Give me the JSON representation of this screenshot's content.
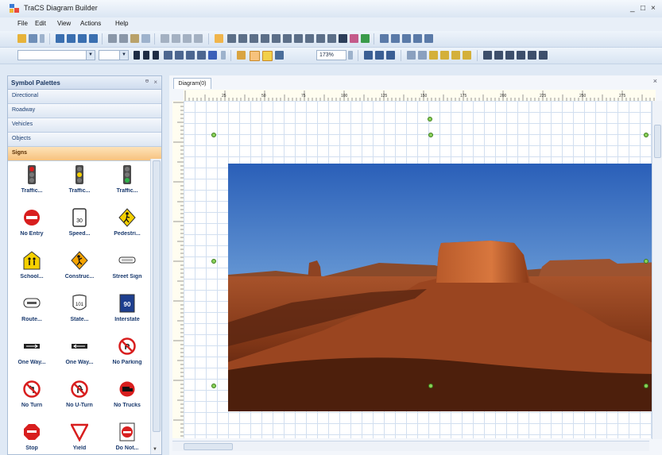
{
  "window": {
    "title": "TraCS Diagram Builder",
    "controls": {
      "minimize": "_",
      "maximize": "□",
      "close": "×"
    }
  },
  "menu": [
    "File",
    "Edit",
    "View",
    "Actions",
    "Help"
  ],
  "toolbar": {
    "zoom_value": "173%"
  },
  "palette": {
    "title": "Symbol Palettes",
    "pin": "ᵿ",
    "close": "×",
    "categories": [
      "Directional",
      "Roadway",
      "Vehicles",
      "Objects",
      "Signs"
    ],
    "active_category": "Signs",
    "symbols": [
      {
        "label": "Traffic...",
        "icon": "traffic-light-icon"
      },
      {
        "label": "Traffic...",
        "icon": "traffic-light-icon"
      },
      {
        "label": "Traffic...",
        "icon": "traffic-light-icon"
      },
      {
        "label": "No Entry",
        "icon": "no-entry-icon"
      },
      {
        "label": "Speed...",
        "icon": "speed-limit-icon"
      },
      {
        "label": "Pedestri...",
        "icon": "pedestrian-sign-icon"
      },
      {
        "label": "School...",
        "icon": "school-sign-icon"
      },
      {
        "label": "Construc...",
        "icon": "construction-sign-icon"
      },
      {
        "label": "Street Sign",
        "icon": "street-sign-icon"
      },
      {
        "label": "Route...",
        "icon": "route-sign-icon"
      },
      {
        "label": "State...",
        "icon": "state-route-icon"
      },
      {
        "label": "Interstate",
        "icon": "interstate-icon"
      },
      {
        "label": "One Way...",
        "icon": "one-way-icon"
      },
      {
        "label": "One Way...",
        "icon": "one-way-icon"
      },
      {
        "label": "No Parking",
        "icon": "no-parking-icon"
      },
      {
        "label": "No Turn",
        "icon": "no-turn-icon"
      },
      {
        "label": "No U-Turn",
        "icon": "no-u-turn-icon"
      },
      {
        "label": "No Trucks",
        "icon": "no-trucks-icon"
      },
      {
        "label": "Stop",
        "icon": "stop-sign-icon"
      },
      {
        "label": "Yield",
        "icon": "yield-sign-icon"
      },
      {
        "label": "Do Not...",
        "icon": "do-not-enter-icon"
      }
    ],
    "speed_number": "30",
    "state_number": "101",
    "interstate_number": "90"
  },
  "document": {
    "tab": "Diagram(0)",
    "close": "×",
    "ruler_ticks": [
      "25",
      "50",
      "75",
      "100",
      "125",
      "150",
      "175",
      "200",
      "225",
      "250",
      "275",
      "300",
      "325"
    ]
  },
  "colors": {
    "accent": "#f7c27d",
    "sign_red": "#d81e1e",
    "sign_yellow": "#f5d000",
    "interstate_blue": "#1e3f8f",
    "handle_green": "#8ad15a"
  }
}
